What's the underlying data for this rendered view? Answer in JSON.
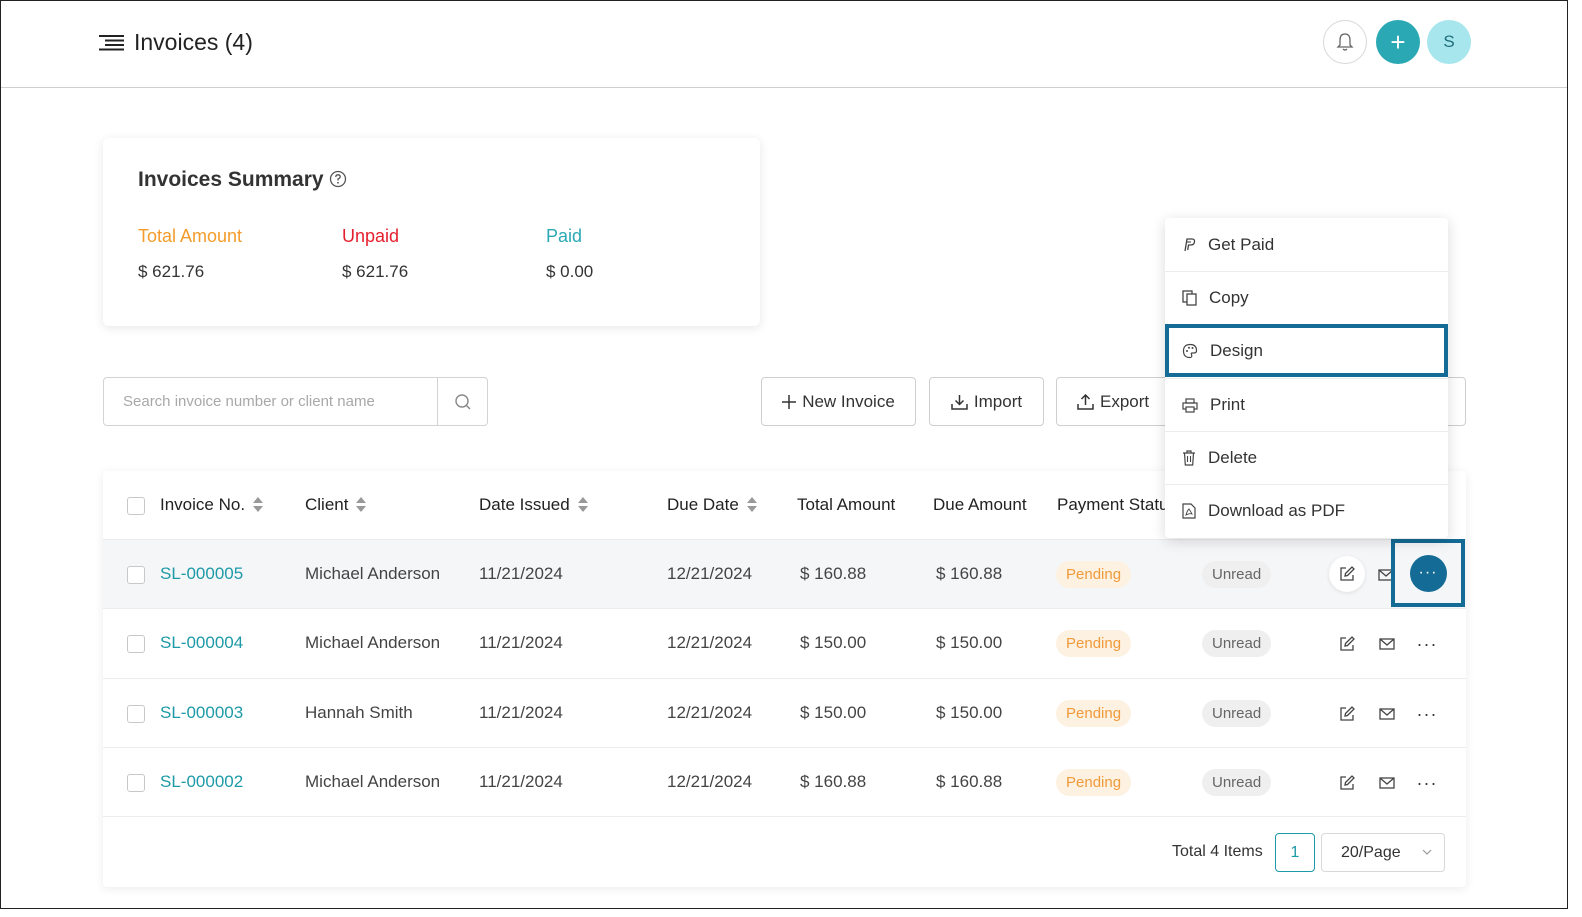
{
  "header": {
    "title": "Invoices (4)",
    "avatar_letter": "S",
    "add_symbol": "+"
  },
  "summary": {
    "title": "Invoices Summary",
    "stats": [
      {
        "label": "Total Amount",
        "value": "$ 621.76",
        "color": "#f39c2b"
      },
      {
        "label": "Unpaid",
        "value": "$ 621.76",
        "color": "#e5202e"
      },
      {
        "label": "Paid",
        "value": "$ 0.00",
        "color": "#2aa9b4"
      }
    ]
  },
  "search": {
    "placeholder": "Search invoice number or client name",
    "value": ""
  },
  "toolbar": {
    "new_invoice": "New Invoice",
    "import": "Import",
    "export": "Export"
  },
  "table": {
    "columns": [
      "Invoice No.",
      "Client",
      "Date Issued",
      "Due Date",
      "Total Amount",
      "Due Amount",
      "Payment Status"
    ],
    "rows": [
      {
        "invoice": "SL-000005",
        "client": "Michael Anderson",
        "issued": "11/21/2024",
        "due": "12/21/2024",
        "total": "$ 160.88",
        "due_amount": "$ 160.88",
        "payment": "Pending",
        "read": "Unread"
      },
      {
        "invoice": "SL-000004",
        "client": "Michael Anderson",
        "issued": "11/21/2024",
        "due": "12/21/2024",
        "total": "$ 150.00",
        "due_amount": "$ 150.00",
        "payment": "Pending",
        "read": "Unread"
      },
      {
        "invoice": "SL-000003",
        "client": "Hannah Smith",
        "issued": "11/21/2024",
        "due": "12/21/2024",
        "total": "$ 150.00",
        "due_amount": "$ 150.00",
        "payment": "Pending",
        "read": "Unread"
      },
      {
        "invoice": "SL-000002",
        "client": "Michael Anderson",
        "issued": "11/21/2024",
        "due": "12/21/2024",
        "total": "$ 160.88",
        "due_amount": "$ 160.88",
        "payment": "Pending",
        "read": "Unread"
      }
    ]
  },
  "pagination": {
    "total": "Total 4 Items",
    "current_page": "1",
    "page_size": "20/Page"
  },
  "dropdown": {
    "items": [
      {
        "label": "Get Paid",
        "icon": "paypal-icon"
      },
      {
        "label": "Copy",
        "icon": "copy-icon"
      },
      {
        "label": "Design",
        "icon": "palette-icon"
      },
      {
        "label": "Print",
        "icon": "printer-icon"
      },
      {
        "label": "Delete",
        "icon": "trash-icon"
      },
      {
        "label": "Download as PDF",
        "icon": "pdf-icon"
      }
    ],
    "selected": "Design"
  },
  "colors": {
    "accent": "#2aa9b4",
    "highlight_border": "#146b95",
    "pending_text": "#f09a3a",
    "link": "#1d9aa7"
  }
}
